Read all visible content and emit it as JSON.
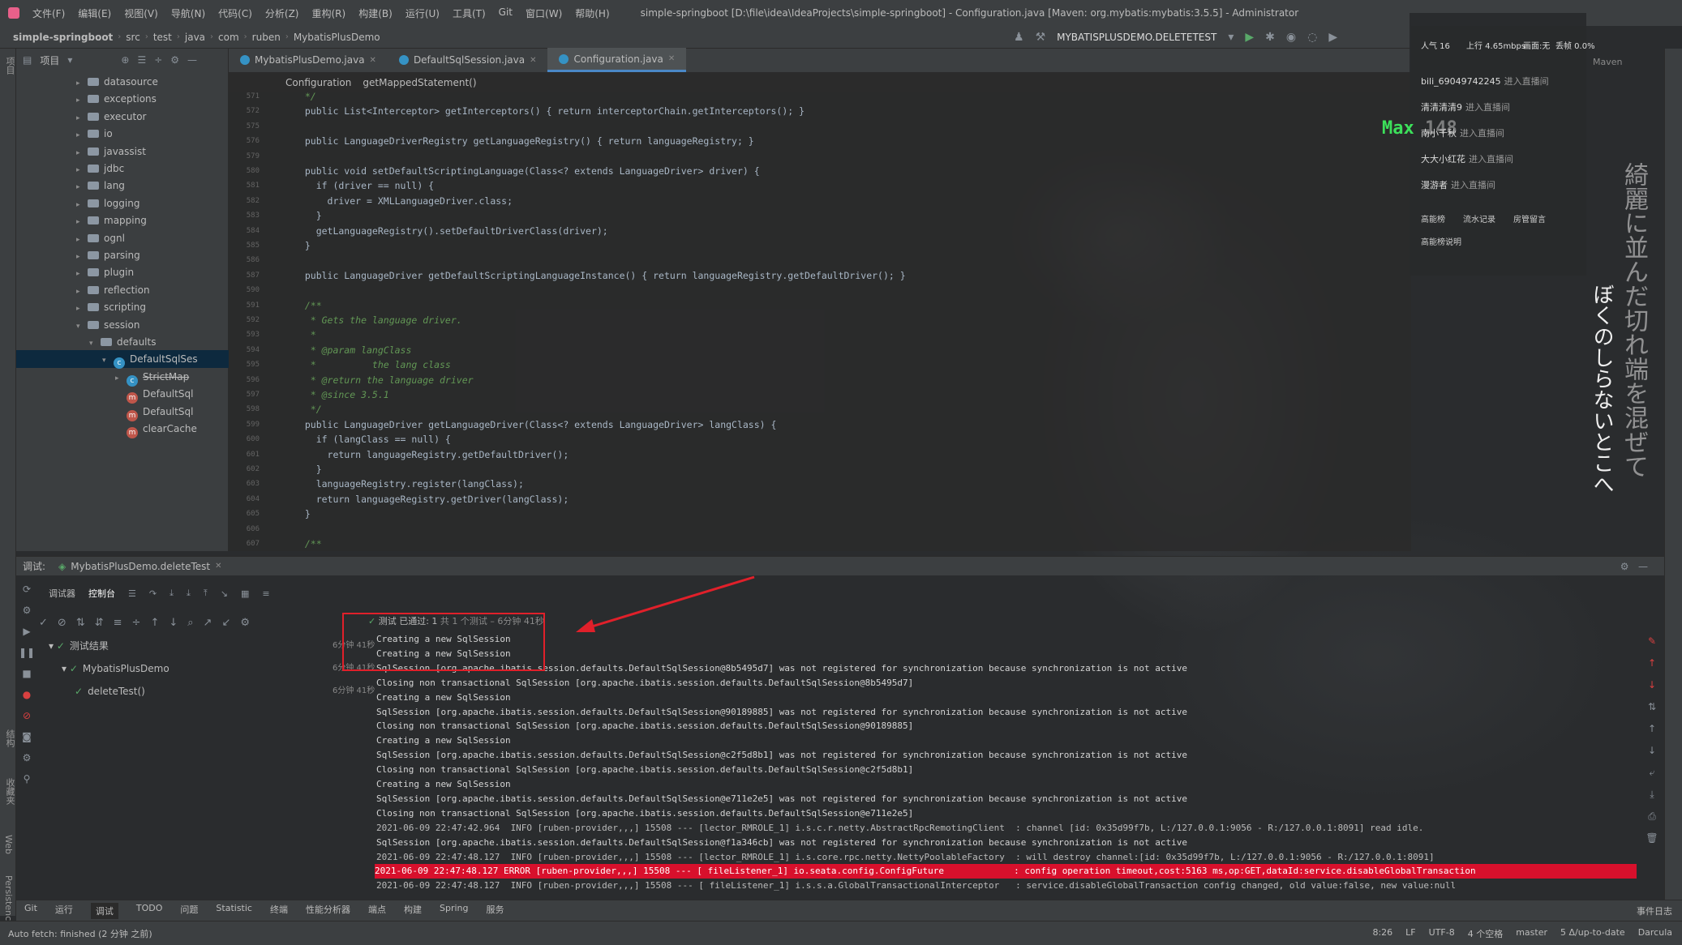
{
  "menubar": {
    "items": [
      "文件(F)",
      "编辑(E)",
      "视图(V)",
      "导航(N)",
      "代码(C)",
      "分析(Z)",
      "重构(R)",
      "构建(B)",
      "运行(U)",
      "工具(T)",
      "Git",
      "窗口(W)",
      "帮助(H)"
    ],
    "window_title": "simple-springboot [D:\\file\\idea\\IdeaProjects\\simple-springboot] - Configuration.java [Maven: org.mybatis:mybatis:3.5.5] - Administrator"
  },
  "navbar": {
    "crumbs": [
      "simple-springboot",
      "src",
      "test",
      "java",
      "com",
      "ruben",
      "MybatisPlusDemo"
    ],
    "run_config": "MYBATISPLUSDEMO.DELETETEST"
  },
  "left_stripe": {
    "labels": [
      "项目",
      "结构",
      "收藏夹",
      "Web",
      "Persistence"
    ]
  },
  "project": {
    "title": "项目",
    "tree": [
      {
        "label": "datasource",
        "kind": "folder",
        "depth": 0
      },
      {
        "label": "exceptions",
        "kind": "folder",
        "depth": 0
      },
      {
        "label": "executor",
        "kind": "folder",
        "depth": 0
      },
      {
        "label": "io",
        "kind": "folder",
        "depth": 0
      },
      {
        "label": "javassist",
        "kind": "folder",
        "depth": 0
      },
      {
        "label": "jdbc",
        "kind": "folder",
        "depth": 0
      },
      {
        "label": "lang",
        "kind": "folder",
        "depth": 0
      },
      {
        "label": "logging",
        "kind": "folder",
        "depth": 0
      },
      {
        "label": "mapping",
        "kind": "folder",
        "depth": 0
      },
      {
        "label": "ognl",
        "kind": "folder",
        "depth": 0
      },
      {
        "label": "parsing",
        "kind": "folder",
        "depth": 0
      },
      {
        "label": "plugin",
        "kind": "folder",
        "depth": 0
      },
      {
        "label": "reflection",
        "kind": "folder",
        "depth": 0
      },
      {
        "label": "scripting",
        "kind": "folder",
        "depth": 0
      },
      {
        "label": "session",
        "kind": "folder-open",
        "depth": 0
      },
      {
        "label": "defaults",
        "kind": "folder-open",
        "depth": 1
      },
      {
        "label": "DefaultSqlSes",
        "kind": "class-open",
        "depth": 2
      },
      {
        "label": "StrictMap",
        "kind": "class",
        "depth": 3
      },
      {
        "label": "DefaultSql",
        "kind": "method",
        "depth": 3
      },
      {
        "label": "DefaultSql",
        "kind": "method",
        "depth": 3
      },
      {
        "label": "clearCache",
        "kind": "method",
        "depth": 3
      }
    ]
  },
  "editor": {
    "tabs": [
      {
        "label": "MybatisPlusDemo.java",
        "active": false
      },
      {
        "label": "DefaultSqlSession.java",
        "active": false
      },
      {
        "label": "Configuration.java",
        "active": true
      }
    ],
    "crumbs": [
      "Configuration",
      "getMappedStatement()"
    ],
    "lines": [
      {
        "n": "571",
        "text": "  */"
      },
      {
        "n": "572",
        "text": "  public List<Interceptor> getInterceptors() { return interceptorChain.getInterceptors(); }"
      },
      {
        "n": "575",
        "text": ""
      },
      {
        "n": "576",
        "text": "  public LanguageDriverRegistry getLanguageRegistry() { return languageRegistry; }"
      },
      {
        "n": "579",
        "text": ""
      },
      {
        "n": "580",
        "text": "  public void setDefaultScriptingLanguage(Class<? extends LanguageDriver> driver) {"
      },
      {
        "n": "581",
        "text": "    if (driver == null) {"
      },
      {
        "n": "582",
        "text": "      driver = XMLLanguageDriver.class;"
      },
      {
        "n": "583",
        "text": "    }"
      },
      {
        "n": "584",
        "text": "    getLanguageRegistry().setDefaultDriverClass(driver);"
      },
      {
        "n": "585",
        "text": "  }"
      },
      {
        "n": "586",
        "text": ""
      },
      {
        "n": "587",
        "text": "  public LanguageDriver getDefaultScriptingLanguageInstance() { return languageRegistry.getDefaultDriver(); }"
      },
      {
        "n": "590",
        "text": ""
      },
      {
        "n": "591",
        "text": "  /**"
      },
      {
        "n": "592",
        "text": "   * Gets the language driver."
      },
      {
        "n": "593",
        "text": "   *"
      },
      {
        "n": "594",
        "text": "   * @param langClass"
      },
      {
        "n": "595",
        "text": "   *          the lang class"
      },
      {
        "n": "596",
        "text": "   * @return the language driver"
      },
      {
        "n": "597",
        "text": "   * @since 3.5.1"
      },
      {
        "n": "598",
        "text": "   */"
      },
      {
        "n": "599",
        "text": "  public LanguageDriver getLanguageDriver(Class<? extends LanguageDriver> langClass) {"
      },
      {
        "n": "600",
        "text": "    if (langClass == null) {"
      },
      {
        "n": "601",
        "text": "      return languageRegistry.getDefaultDriver();"
      },
      {
        "n": "602",
        "text": "    }"
      },
      {
        "n": "603",
        "text": "    languageRegistry.register(langClass);"
      },
      {
        "n": "604",
        "text": "    return languageRegistry.getDriver(langClass);"
      },
      {
        "n": "605",
        "text": "  }"
      },
      {
        "n": "606",
        "text": ""
      },
      {
        "n": "607",
        "text": "  /**"
      }
    ]
  },
  "overlay": {
    "stats": [
      "人气 16",
      "上行 4.65mbps",
      "画面:无",
      "丢帧 0.0%"
    ],
    "chats": [
      {
        "user": "bili_69049742245",
        "msg": "进入直播间"
      },
      {
        "user": "清清清清9",
        "msg": "进入直播间"
      },
      {
        "user": "南小千秋",
        "msg": "进入直播间"
      },
      {
        "user": "大大小红花",
        "msg": "进入直播间"
      },
      {
        "user": "漫游者",
        "msg": "进入直播间"
      }
    ],
    "buttons": [
      "高能榜",
      "流水记录",
      "房管留言"
    ],
    "note": "高能榜说明",
    "max_label": "Max",
    "max_value": "148",
    "maven": "Maven"
  },
  "jp_text": "ぼくのしらないとこへ",
  "jp_text2": "綺麗に並んだ切れ端を混ぜて",
  "debug": {
    "header_label": "调试:",
    "run_tab": "MybatisPlusDemo.deleteTest",
    "tabs": [
      "调试器",
      "控制台"
    ],
    "status_check": "✓",
    "status_text": "测试 已通过: 1",
    "status_detail": "共 1 个测试 – 6分钟 41秒",
    "tests": [
      {
        "label": "测试结果",
        "dur": "6分钟 41秒",
        "depth": 0
      },
      {
        "label": "MybatisPlusDemo",
        "dur": "6分钟 41秒",
        "depth": 1
      },
      {
        "label": "deleteTest()",
        "dur": "6分钟 41秒",
        "depth": 2
      }
    ],
    "console": [
      {
        "t": "Creating a new SqlSession",
        "k": "normal"
      },
      {
        "t": "Creating a new SqlSession",
        "k": "normal"
      },
      {
        "t": "SqlSession [org.apache.ibatis.session.defaults.DefaultSqlSession@8b5495d7] was not registered for synchronization because synchronization is not active",
        "k": "normal"
      },
      {
        "t": "Closing non transactional SqlSession [org.apache.ibatis.session.defaults.DefaultSqlSession@8b5495d7]",
        "k": "normal"
      },
      {
        "t": "Creating a new SqlSession",
        "k": "normal"
      },
      {
        "t": "SqlSession [org.apache.ibatis.session.defaults.DefaultSqlSession@90189885] was not registered for synchronization because synchronization is not active",
        "k": "normal"
      },
      {
        "t": "Closing non transactional SqlSession [org.apache.ibatis.session.defaults.DefaultSqlSession@90189885]",
        "k": "normal"
      },
      {
        "t": "Creating a new SqlSession",
        "k": "normal"
      },
      {
        "t": "SqlSession [org.apache.ibatis.session.defaults.DefaultSqlSession@c2f5d8b1] was not registered for synchronization because synchronization is not active",
        "k": "normal"
      },
      {
        "t": "Closing non transactional SqlSession [org.apache.ibatis.session.defaults.DefaultSqlSession@c2f5d8b1]",
        "k": "normal"
      },
      {
        "t": "Creating a new SqlSession",
        "k": "normal"
      },
      {
        "t": "SqlSession [org.apache.ibatis.session.defaults.DefaultSqlSession@e711e2e5] was not registered for synchronization because synchronization is not active",
        "k": "normal"
      },
      {
        "t": "Closing non transactional SqlSession [org.apache.ibatis.session.defaults.DefaultSqlSession@e711e2e5]",
        "k": "normal"
      },
      {
        "t": "2021-06-09 22:47:42.964  INFO [ruben-provider,,,] 15508 --- [lector_RMROLE_1] i.s.c.r.netty.AbstractRpcRemotingClient  : channel [id: 0x35d99f7b, L:/127.0.0.1:9056 - R:/127.0.0.1:8091] read idle.",
        "k": "info"
      },
      {
        "t": "SqlSession [org.apache.ibatis.session.defaults.DefaultSqlSession@f1a346cb] was not registered for synchronization because synchronization is not active",
        "k": "normal"
      },
      {
        "t": "2021-06-09 22:47:48.127  INFO [ruben-provider,,,] 15508 --- [lector_RMROLE_1] i.s.core.rpc.netty.NettyPoolableFactory  : will destroy channel:[id: 0x35d99f7b, L:/127.0.0.1:9056 - R:/127.0.0.1:8091]",
        "k": "info"
      },
      {
        "t": "2021-06-09 22:47:48.127 ERROR [ruben-provider,,,] 15508 --- [ fileListener_1] io.seata.config.ConfigFuture             : config operation timeout,cost:5163 ms,op:GET,dataId:service.disableGlobalTransaction",
        "k": "error"
      },
      {
        "t": "2021-06-09 22:47:48.127  INFO [ruben-provider,,,] 15508 --- [ fileListener_1] i.s.s.a.GlobalTransactionalInterceptor   : service.disableGlobalTransaction config changed, old value:false, new value:null",
        "k": "info"
      }
    ]
  },
  "bottom_toolbar": [
    "Git",
    "运行",
    "调试",
    "TODO",
    "问题",
    "Statistic",
    "终端",
    "性能分析器",
    "端点",
    "构建",
    "Spring",
    "服务"
  ],
  "bottom_active": "调试",
  "event_log": "事件日志",
  "statusbar": {
    "message": "Auto fetch: finished (2 分钟 之前)",
    "items": [
      "8:26",
      "LF",
      "UTF-8",
      "4 个空格",
      "master",
      "5 Δ/up-to-date",
      "Darcula"
    ]
  },
  "colors": {
    "error_bg": "#d8102c",
    "pass": "#59a869",
    "annotation_red": "#e0202a",
    "max_badge": "#3ce05a"
  }
}
